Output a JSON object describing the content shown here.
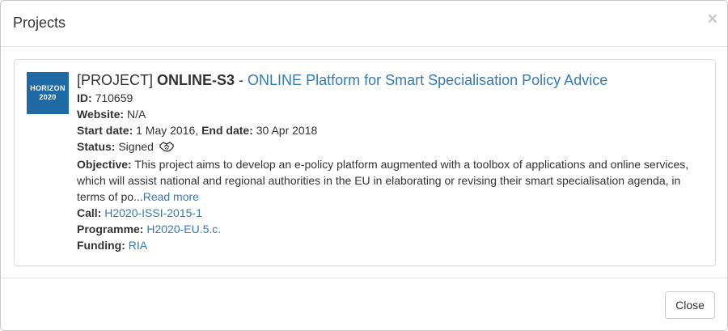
{
  "modal": {
    "title": "Projects",
    "close_symbol": "×"
  },
  "logo": {
    "line1": "HORIZON",
    "line2": "2020"
  },
  "project": {
    "prefix": "[PROJECT]",
    "acronym": "ONLINE-S3",
    "separator": " - ",
    "title": "ONLINE Platform for Smart Specialisation Policy Advice",
    "id_label": "ID:",
    "id_value": "710659",
    "website_label": "Website:",
    "website_value": "N/A",
    "start_label": "Start date:",
    "start_value": "1 May 2016",
    "end_label": "End date:",
    "end_value": "30 Apr 2018",
    "status_label": "Status:",
    "status_value": "Signed",
    "status_icon": "handshake-icon",
    "objective_label": "Objective:",
    "objective_text": "This project aims to develop an e-policy platform augmented with a toolbox of applications and online services, which will assist national and regional authorities in the EU in elaborating or revising their smart specialisation agenda, in terms of po...",
    "read_more": "Read more",
    "call_label": "Call:",
    "call_value": "H2020-ISSI-2015-1",
    "programme_label": "Programme:",
    "programme_value": "H2020-EU.5.c.",
    "funding_label": "Funding:",
    "funding_value": "RIA"
  },
  "footer": {
    "close_label": "Close"
  }
}
